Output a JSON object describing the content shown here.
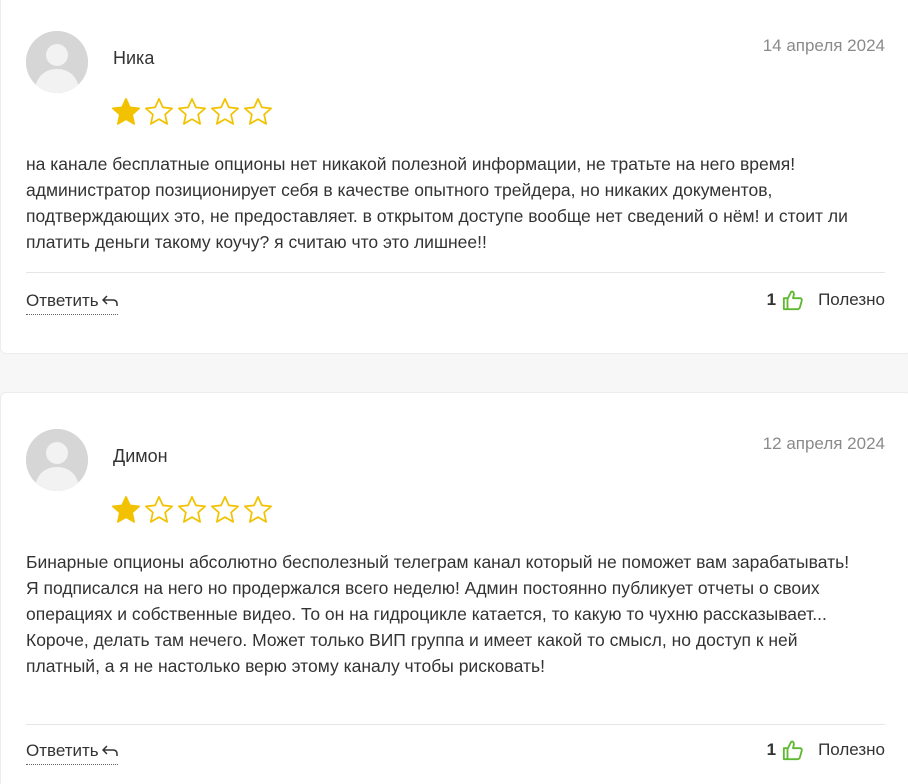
{
  "reviews": [
    {
      "author": "Ника",
      "date": "14 апреля 2024",
      "rating": 1,
      "max_rating": 5,
      "text": "на канале бесплатные опционы нет никакой полезной информации, не тратьте на него время! администратор позиционирует себя в качестве опытного трейдера, но никаких документов, подтверждающих это, не предоставляет. в открытом доступе вообще нет сведений о нём! и стоит ли платить деньги такому коучу? я считаю что это лишнее!!",
      "reply_label": "Ответить",
      "likes": "1",
      "useful_label": "Полезно"
    },
    {
      "author": "Димон",
      "date": "12 апреля 2024",
      "rating": 1,
      "max_rating": 5,
      "text": "Бинарные опционы абсолютно бесполезный телеграм канал который не поможет вам зарабатывать! Я подписался на него но продержался всего неделю! Админ постоянно публикует отчеты о своих операциях и собственные видео. То он на гидроцикле катается, то какую то чухню рассказывает... Короче, делать там нечего. Может только ВИП группа и имеет какой то смысл, но доступ к ней платный, а я не настолько верю этому каналу чтобы рисковать!",
      "reply_label": "Ответить",
      "likes": "1",
      "useful_label": "Полезно"
    }
  ],
  "icons": {
    "star_filled": "star-filled-icon",
    "star_empty": "star-empty-icon",
    "reply": "reply-arrow-icon",
    "like": "thumbs-up-icon",
    "avatar": "user-avatar-icon"
  },
  "colors": {
    "star": "#f2c200",
    "like": "#5fb832",
    "date": "#8a8a8a"
  }
}
